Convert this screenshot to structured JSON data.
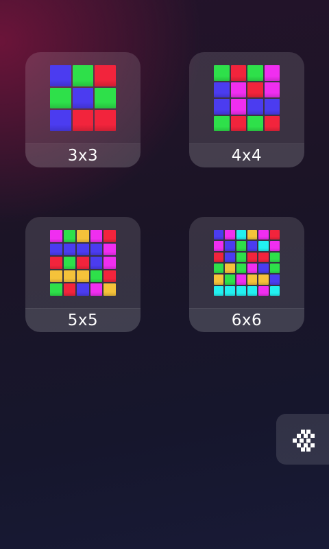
{
  "levels": [
    {
      "label": "3x3",
      "size": 3,
      "cells": [
        "blue",
        "green",
        "red",
        "green",
        "blue",
        "green",
        "blue",
        "red",
        "red"
      ]
    },
    {
      "label": "4x4",
      "size": 4,
      "cells": [
        "green",
        "red",
        "green",
        "magenta",
        "blue",
        "magenta",
        "red",
        "magenta",
        "blue",
        "magenta",
        "blue",
        "blue",
        "green",
        "red",
        "green",
        "red"
      ]
    },
    {
      "label": "5x5",
      "size": 5,
      "cells": [
        "magenta",
        "green",
        "yellow",
        "magenta",
        "red",
        "blue",
        "blue",
        "blue",
        "blue",
        "magenta",
        "red",
        "green",
        "red",
        "blue",
        "magenta",
        "yellow",
        "yellow",
        "yellow",
        "green",
        "red",
        "green",
        "red",
        "blue",
        "magenta",
        "yellow"
      ]
    },
    {
      "label": "6x6",
      "size": 6,
      "cells": [
        "blue",
        "magenta",
        "cyan",
        "yellow",
        "magenta",
        "red",
        "magenta",
        "blue",
        "green",
        "blue",
        "cyan",
        "magenta",
        "red",
        "blue",
        "green",
        "red",
        "red",
        "green",
        "green",
        "yellow",
        "green",
        "magenta",
        "blue",
        "green",
        "yellow",
        "green",
        "magenta",
        "yellow",
        "yellow",
        "blue",
        "cyan",
        "cyan",
        "cyan",
        "cyan",
        "magenta",
        "cyan"
      ]
    }
  ],
  "palette": {
    "blue": "#4b3cf0",
    "green": "#2ee04a",
    "red": "#f2243c",
    "magenta": "#f02ef0",
    "yellow": "#f5c23a",
    "cyan": "#22f0f0"
  },
  "back_button": {
    "icon": "back-arrow-icon"
  }
}
